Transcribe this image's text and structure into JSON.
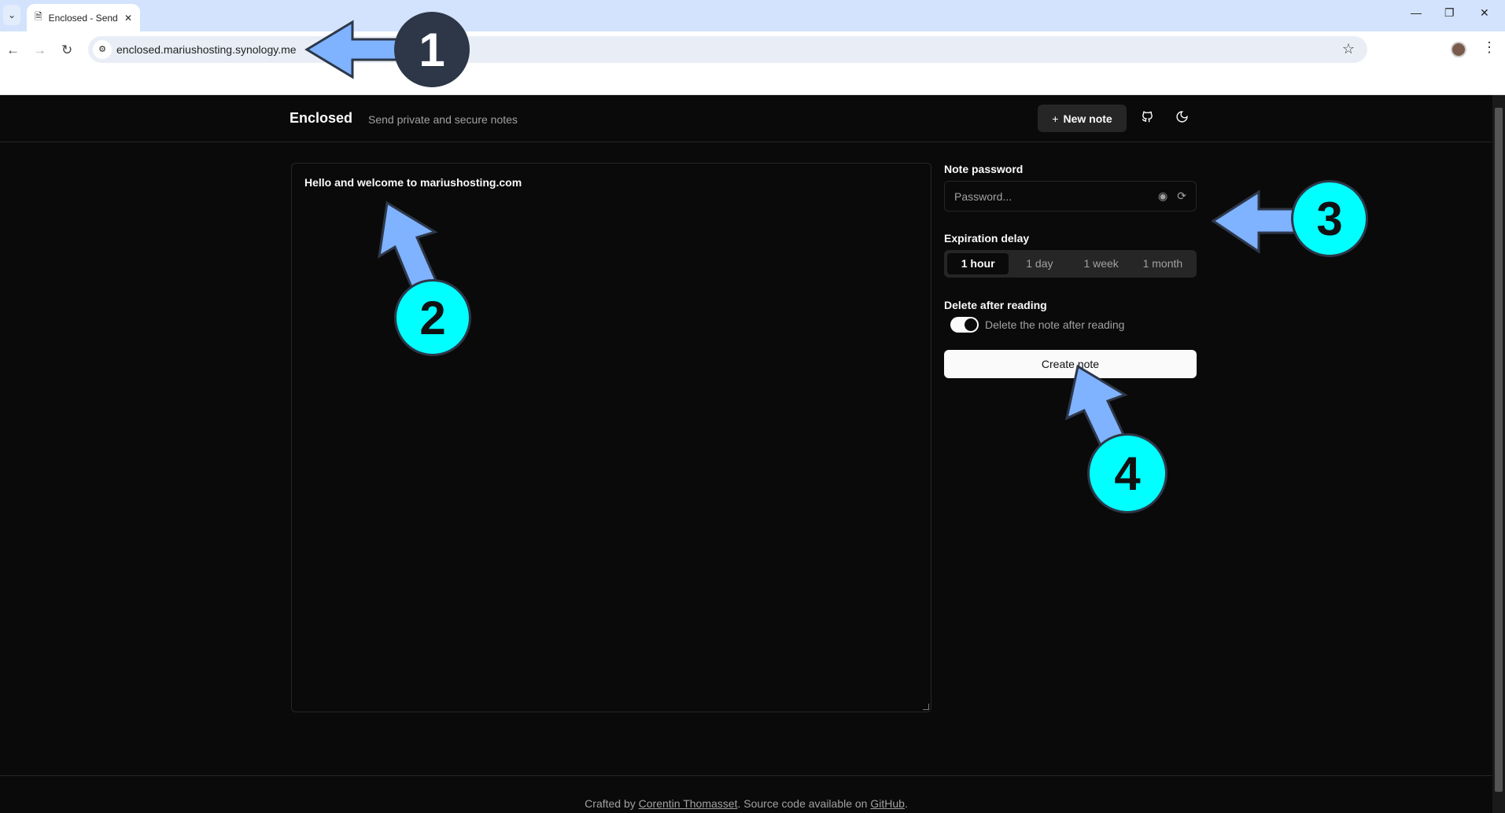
{
  "browser": {
    "tab_title": "Enclosed - Send private and secure notes",
    "url": "enclosed.mariushosting.synology.me"
  },
  "header": {
    "brand": "Enclosed",
    "tagline": "Send private and secure notes",
    "new_note": "New note"
  },
  "editor": {
    "content": "Hello and welcome to mariushosting.com"
  },
  "panel": {
    "password_label": "Note password",
    "password_placeholder": "Password...",
    "expiration_label": "Expiration delay",
    "expiration_options": [
      "1 hour",
      "1 day",
      "1 week",
      "1 month"
    ],
    "expiration_selected": "1 hour",
    "delete_label": "Delete after reading",
    "delete_toggle_text": "Delete the note after reading",
    "delete_enabled": true,
    "create": "Create note"
  },
  "footer": {
    "prefix": "Crafted by ",
    "author": "Corentin Thomasset",
    "middle": ". Source code available on ",
    "github": "GitHub",
    "suffix": "."
  },
  "annotations": [
    "1",
    "2",
    "3",
    "4"
  ],
  "colors": {
    "arrow": "#7fb2ff",
    "circle_cyan": "#00ffff",
    "circle_dark": "#2d3748"
  }
}
